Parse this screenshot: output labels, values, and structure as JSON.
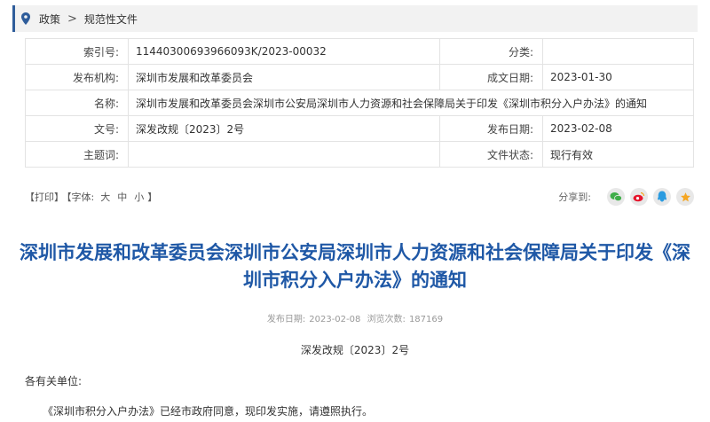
{
  "breadcrumb": {
    "items": [
      "政策",
      "规范性文件"
    ],
    "separator": ">"
  },
  "info": {
    "index_label": "索引号:",
    "index_value": "11440300693966093K/2023-00032",
    "category_label": "分类:",
    "category_value": "",
    "publisher_label": "发布机构:",
    "publisher_value": "深圳市发展和改革委员会",
    "written_date_label": "成文日期:",
    "written_date_value": "2023-01-30",
    "name_label": "名称:",
    "name_value": "深圳市发展和改革委员会深圳市公安局深圳市人力资源和社会保障局关于印发《深圳市积分入户办法》的通知",
    "doc_no_label": "文号:",
    "doc_no_value": "深发改规〔2023〕2号",
    "publish_date_label": "发布日期:",
    "publish_date_value": "2023-02-08",
    "subject_label": "主题词:",
    "subject_value": "",
    "status_label": "文件状态:",
    "status_value": "现行有效"
  },
  "tools": {
    "print": "【打印】",
    "font_prefix": "【字体:",
    "font_large": "大",
    "font_medium": "中",
    "font_small": "小",
    "font_suffix": "】",
    "share_label": "分享到:"
  },
  "colors": {
    "accent": "#2f5d9b",
    "title": "#1f58a6",
    "wechat": "#3fae49",
    "weibo": "#e6162d",
    "qzone": "#2a9be0",
    "favorite": "#f5a623"
  },
  "article": {
    "title": "深圳市发展和改革委员会深圳市公安局深圳市人力资源和社会保障局关于印发《深圳市积分入户办法》的通知",
    "publish_label": "发布日期:",
    "publish_date": "2023-02-08",
    "views_label": "浏览次数:",
    "views": "187169",
    "doc_number": "深发改规〔2023〕2号",
    "salutation": "各有关单位:",
    "para1": "《深圳市积分入户办法》已经市政府同意，现印发实施，请遵照执行。"
  }
}
